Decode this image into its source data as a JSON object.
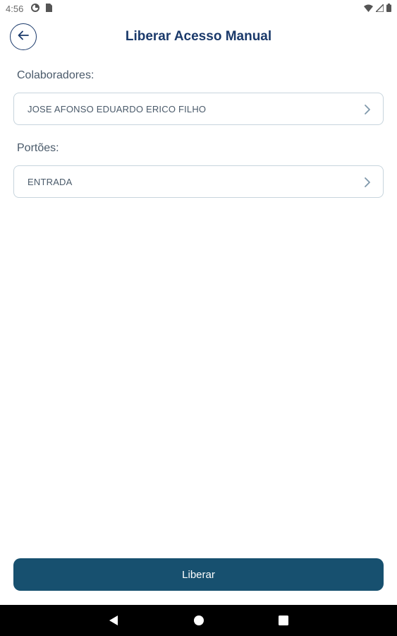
{
  "status_bar": {
    "time": "4:56",
    "left_icons": [
      "data-saver-icon",
      "sim-card-icon"
    ],
    "right_icons": [
      "wifi-icon",
      "signal-icon",
      "battery-icon"
    ]
  },
  "header": {
    "back_icon": "arrow-left-icon",
    "title": "Liberar Acesso Manual"
  },
  "form": {
    "colaboradores": {
      "label": "Colaboradores:",
      "value": "JOSE AFONSO EDUARDO ERICO FILHO",
      "icon": "chevron-right-icon"
    },
    "portoes": {
      "label": "Portões:",
      "value": "ENTRADA",
      "icon": "chevron-right-icon"
    }
  },
  "submit": {
    "label": "Liberar"
  },
  "colors": {
    "primary": "#17506f",
    "title": "#1b3a6b",
    "field_border": "#c7d4dd",
    "text": "#4a5a6a"
  },
  "nav_bar": {
    "buttons": [
      "back-triangle-icon",
      "home-circle-icon",
      "recents-square-icon"
    ]
  }
}
